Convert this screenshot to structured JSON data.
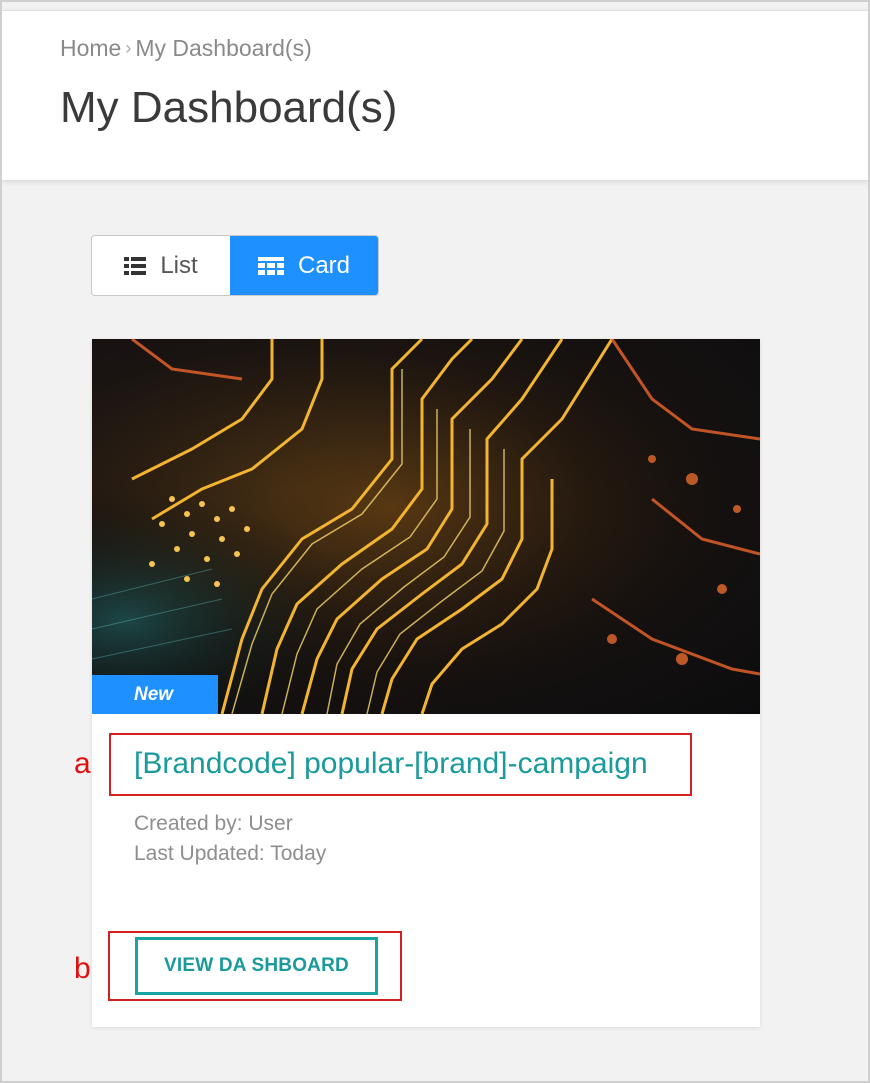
{
  "breadcrumb": {
    "home": "Home",
    "current": "My Dashboard(s)"
  },
  "page": {
    "title": "My Dashboard(s)"
  },
  "view_toggle": {
    "list_label": "List",
    "card_label": "Card",
    "active": "Card"
  },
  "card": {
    "badge": "New",
    "title": "[Brandcode] popular-[brand]-campaign",
    "created_by": "Created by: User",
    "last_updated": "Last Updated: Today",
    "button_label": "VIEW DA SHBOARD"
  },
  "annotations": {
    "a": "a",
    "b": "b"
  },
  "colors": {
    "accent_blue": "#1e90ff",
    "teal": "#1a9a9a",
    "annotation_red": "#d42020"
  }
}
